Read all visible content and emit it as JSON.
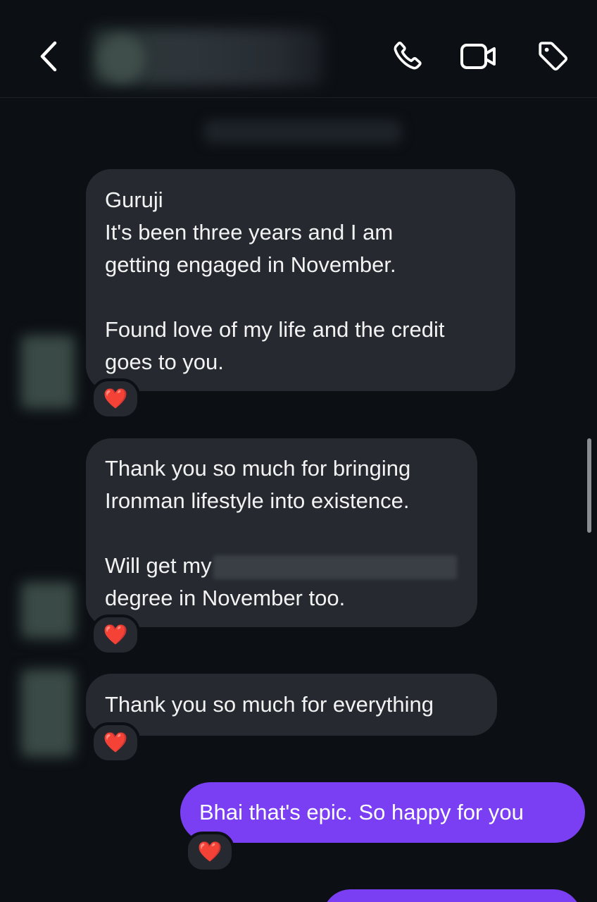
{
  "header": {
    "back_icon": "chevron-left-icon",
    "call_icon": "phone-icon",
    "video_icon": "video-camera-icon",
    "tag_icon": "tag-icon"
  },
  "messages": [
    {
      "direction": "incoming",
      "lines": [
        "Guruji",
        "It's been three years and I am",
        "getting engaged in November.",
        "",
        "Found love of my life and the credit",
        "goes to you."
      ],
      "reaction": "❤️"
    },
    {
      "direction": "incoming",
      "lines": [
        "Thank you so much for bringing",
        "Ironman lifestyle into existence.",
        "",
        "Will get my",
        "degree in November too."
      ],
      "reaction": "❤️"
    },
    {
      "direction": "incoming",
      "lines": [
        "Thank you so much for everything"
      ],
      "reaction": "❤️"
    },
    {
      "direction": "outgoing",
      "lines": [
        "Bhai that's epic. So happy for you"
      ],
      "reaction": "❤️"
    }
  ],
  "colors": {
    "background": "#0c1014",
    "incoming_bubble": "#262a30",
    "outgoing_bubble": "#7a3ff2",
    "heart": "#e8323c"
  }
}
